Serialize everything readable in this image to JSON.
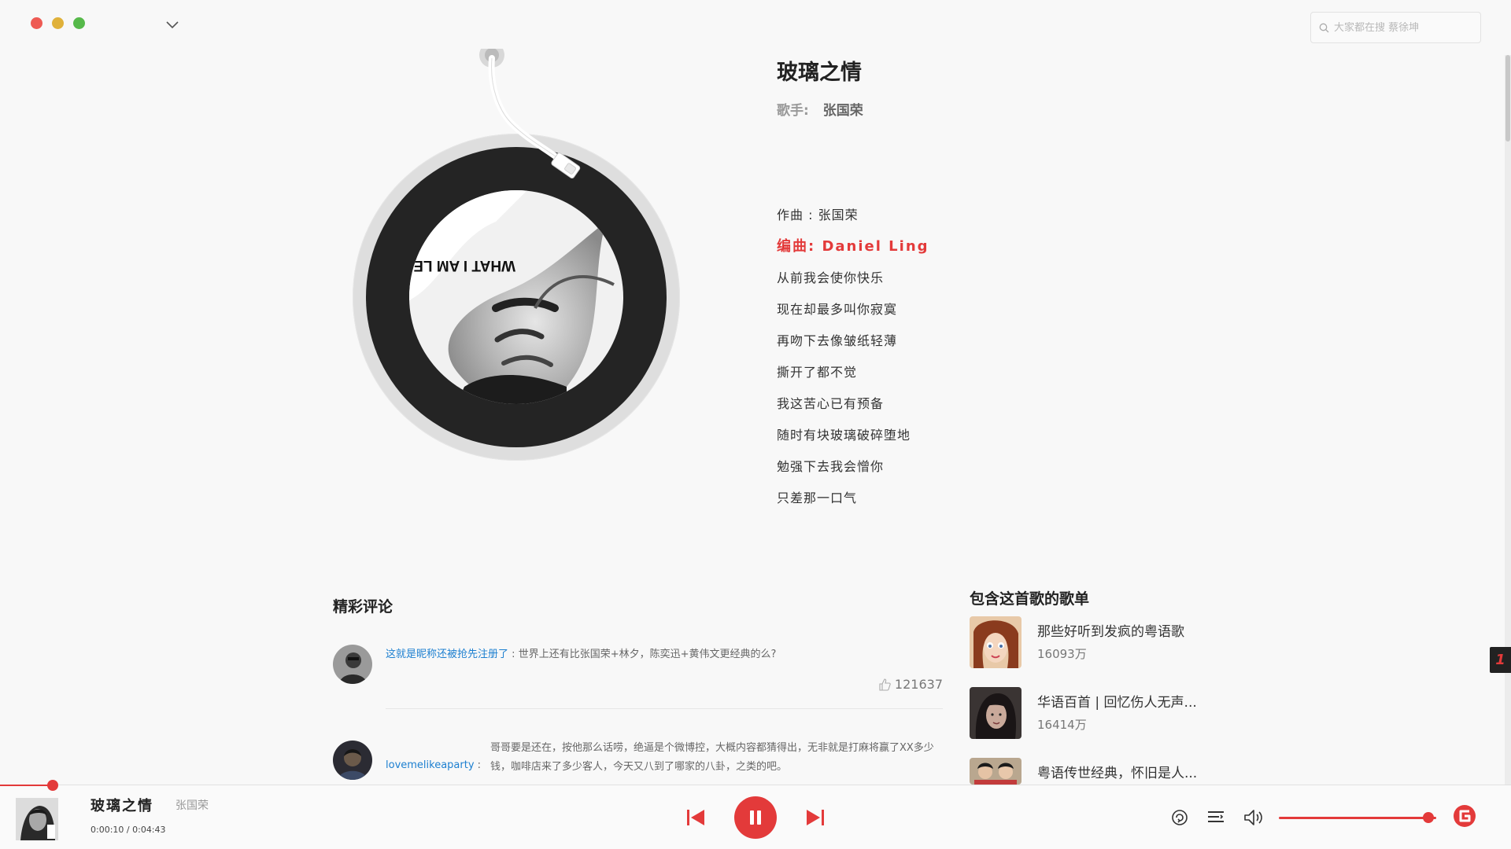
{
  "search": {
    "placeholder": "大家都在搜 蔡徐坤"
  },
  "song": {
    "title": "玻璃之情",
    "singer_label": "歌手:",
    "singer_name": "张国荣",
    "cover_text": "WHAT I AM LESLIE CHEUNG"
  },
  "lyrics": [
    {
      "text": "作曲 : 张国荣",
      "active": false
    },
    {
      "text": "编曲: Daniel Ling",
      "active": true
    },
    {
      "text": "从前我会使你快乐",
      "active": false
    },
    {
      "text": "现在却最多叫你寂寞",
      "active": false
    },
    {
      "text": "再吻下去像皱纸轻薄",
      "active": false
    },
    {
      "text": "撕开了都不觉",
      "active": false
    },
    {
      "text": "我这苦心已有预备",
      "active": false
    },
    {
      "text": "随时有块玻璃破碎堕地",
      "active": false
    },
    {
      "text": "勉强下去我会憎你",
      "active": false
    },
    {
      "text": "只差那一口气",
      "active": false
    }
  ],
  "comments": {
    "title": "精彩评论",
    "items": [
      {
        "user": "这就是昵称还被抢先注册了",
        "sep": ":",
        "text": "世界上还有比张国荣+林夕，陈奕迅+黄伟文更经典的么?",
        "likes": "121637"
      },
      {
        "user": "lovemelikeaparty",
        "sep": ":",
        "text": "哥哥要是还在，按他那么话唠，绝逼是个微博控，大概内容都猜得出，无非就是打麻将赢了XX多少钱，咖啡店来了多少客人，今天又八到了哪家的八卦，之类的吧。",
        "likes": ""
      }
    ]
  },
  "playlists": {
    "title": "包含这首歌的歌单",
    "items": [
      {
        "name": "那些好听到发疯的粤语歌",
        "count": "16093万"
      },
      {
        "name": "华语百首 | 回忆伤人无声...",
        "count": "16414万"
      },
      {
        "name": "粤语传世经典，怀旧是人...",
        "count": ""
      }
    ]
  },
  "player": {
    "title": "玻璃之情",
    "artist": "张国荣",
    "elapsed": "0:00:10",
    "time_sep": " / ",
    "duration": "0:04:43",
    "progress": 0.035,
    "volume": 0.95
  },
  "side_badge": "1",
  "colors": {
    "accent": "#e33a3a",
    "link": "#1c7fd0"
  }
}
